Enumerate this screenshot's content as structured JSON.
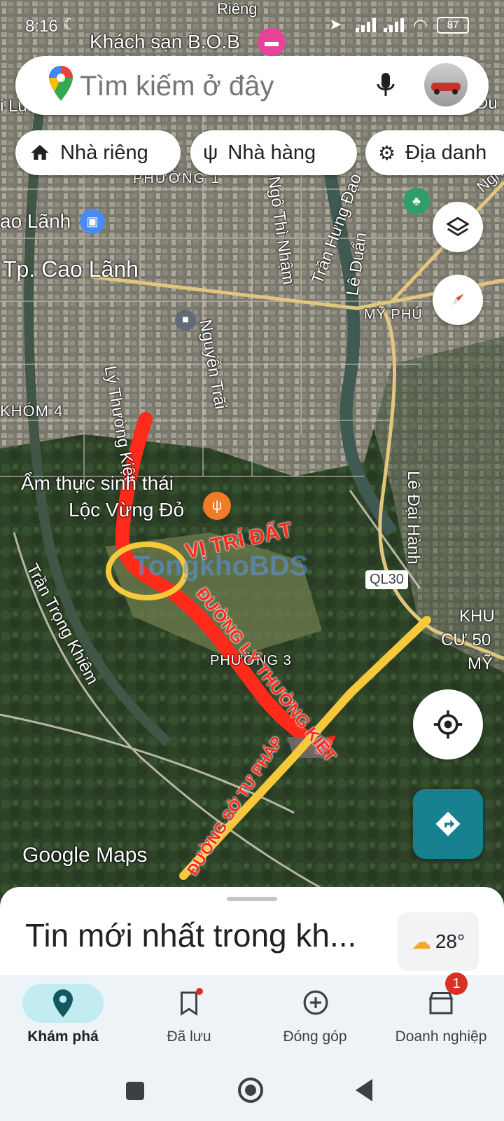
{
  "status": {
    "time": "8:16",
    "battery": "87"
  },
  "search": {
    "placeholder": "Tìm kiếm ở đây"
  },
  "chips": [
    {
      "label": "Nhà riêng",
      "icon": "home-icon"
    },
    {
      "label": "Nhà hàng",
      "icon": "restaurant-icon"
    },
    {
      "label": "Địa danh",
      "icon": "landmark-icon"
    }
  ],
  "map": {
    "places": [
      {
        "text": "Khách sạn B.O.B"
      },
      {
        "text": "Tp. Cao Lãnh"
      },
      {
        "text": "ao Lãnh"
      },
      {
        "text": "PHƯỜNG 1"
      },
      {
        "text": "KHÓM 4"
      },
      {
        "text": "Ẩm thực sinh thái"
      },
      {
        "text": "Lộc Vừng Đỏ"
      },
      {
        "text": "MỸ PHÚ"
      },
      {
        "text": "QL30"
      },
      {
        "text": "KHU"
      },
      {
        "text": "CƯ 50"
      },
      {
        "text": "MỸ"
      },
      {
        "text": "PHƯỜNG 3"
      },
      {
        "text": "i Lựu"
      },
      {
        "text": "Đu"
      },
      {
        "text": "Nghi"
      },
      {
        "text": "Riêng"
      }
    ],
    "streets": [
      {
        "text": "Lý Thường Kiệt"
      },
      {
        "text": "Nguyễn Trãi"
      },
      {
        "text": "Ngô Thì Nhậm"
      },
      {
        "text": "Trần Hưng Đạo"
      },
      {
        "text": "Lê Duẩn"
      },
      {
        "text": "Lê Đại Hành"
      },
      {
        "text": "Trần Trọng Khiêm"
      }
    ],
    "annotations": {
      "vi_tri_dat": "VỊ TRÍ ĐẤT",
      "duong_ly_thuong_kiet": "ĐƯỜNG LÝ THƯỜNG KIỆT",
      "duong_so_tu_phap": "ĐƯỜNG SỞ TƯ PHÁP",
      "watermark": "TongkhoBDS"
    },
    "attribution": "Google Maps",
    "colors": {
      "route_red": "#ff2a1a",
      "route_yellow": "#f6c83a",
      "major_road": "#e8c878"
    }
  },
  "sheet": {
    "title": "Tin mới nhất trong kh...",
    "weather": "28°"
  },
  "nav": [
    {
      "label": "Khám phá",
      "icon": "explore-pin-icon",
      "active": true
    },
    {
      "label": "Đã lưu",
      "icon": "bookmark-icon"
    },
    {
      "label": "Đóng góp",
      "icon": "add-circle-icon"
    },
    {
      "label": "Doanh nghiệp",
      "icon": "store-icon",
      "badge": "1"
    }
  ]
}
